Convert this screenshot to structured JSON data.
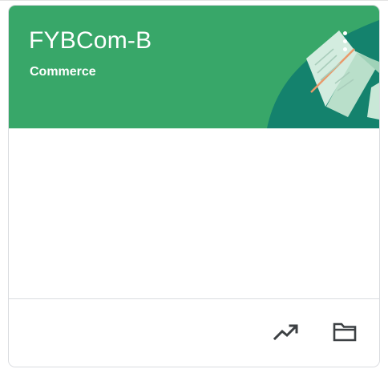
{
  "class_card": {
    "title": "FYBCom-B",
    "section": "Commerce",
    "theme": {
      "header_color": "#38a769",
      "accent_color": "#14826d",
      "text_color": "#ffffff"
    },
    "header_icons": {
      "more": "more-vert-icon"
    },
    "footer": {
      "actions": [
        {
          "icon": "trending-up-icon"
        },
        {
          "icon": "folder-icon"
        }
      ]
    }
  }
}
